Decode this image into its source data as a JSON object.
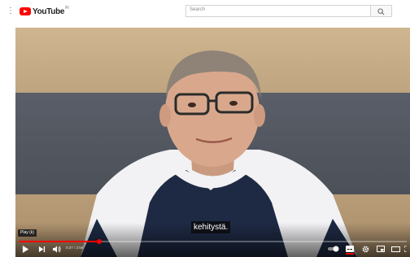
{
  "header": {
    "logo_text": "YouTube",
    "logo_region": "FI",
    "search_placeholder": "Search"
  },
  "player": {
    "subtitle": "kehitystä.",
    "tooltip": "Play (k)",
    "time_display": "0:37 / 2:59",
    "progress": 0.207,
    "icons": {
      "play": "play-icon",
      "next": "next-icon",
      "volume": "volume-icon",
      "autoplay": "autoplay-toggle-icon",
      "captions": "captions-icon",
      "settings": "gear-icon",
      "miniplayer": "miniplayer-icon",
      "theater": "theater-icon",
      "fullscreen": "fullscreen-icon"
    }
  },
  "colors": {
    "brand": "#ff0000",
    "progress": "#ff0000"
  }
}
